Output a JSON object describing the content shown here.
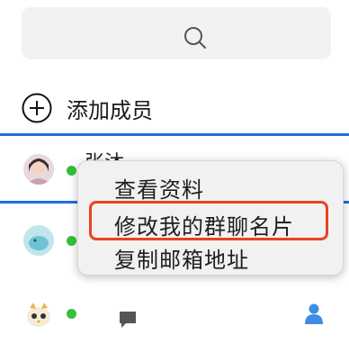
{
  "search": {
    "icon": "search-icon"
  },
  "add_member": {
    "label": "添加成员",
    "icon": "plus-circle-icon"
  },
  "members": [
    {
      "name": "张沐",
      "status": "online",
      "selected": true
    },
    {
      "name": "",
      "status": "online",
      "selected": false
    },
    {
      "name": "",
      "status": "online",
      "selected": false
    }
  ],
  "context_menu": {
    "items": [
      {
        "label": "查看资料"
      },
      {
        "label": "修改我的群聊名片",
        "highlighted": true
      },
      {
        "label": "复制邮箱地址"
      }
    ]
  },
  "colors": {
    "selection_border": "#1e6fe0",
    "highlight_border": "#e8431d",
    "online": "#34c03a",
    "badge": "#f2a23a",
    "person_icon": "#3d8de0"
  }
}
